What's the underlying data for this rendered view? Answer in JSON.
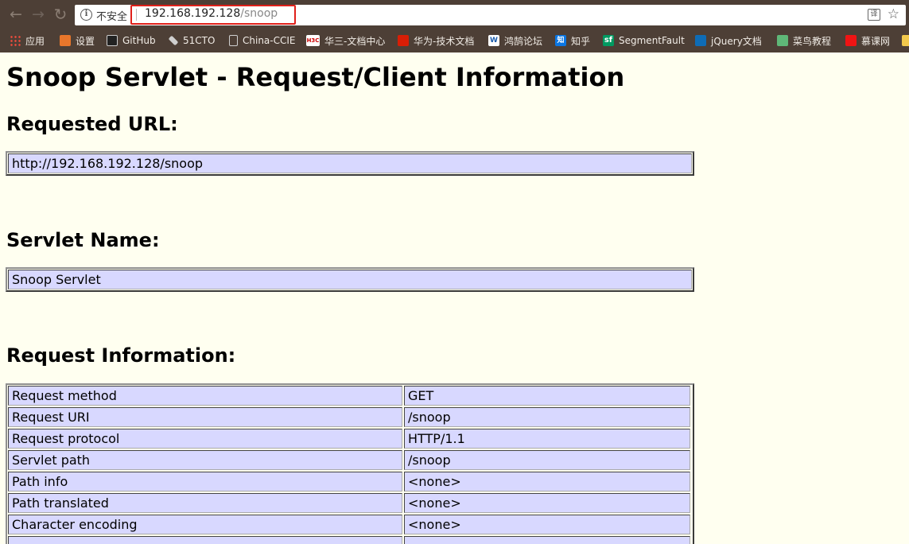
{
  "browser": {
    "insecure_label": "不安全",
    "url_host": "192.168.192.128",
    "url_path": "/snoop",
    "translate_icon": "translate-icon",
    "star_icon": "bookmark-star-icon",
    "bookmarks": [
      {
        "label": "应用",
        "icon": "apps-icon"
      },
      {
        "label": "设置",
        "icon": "gear-icon"
      },
      {
        "label": "GitHub",
        "icon": "github-icon"
      },
      {
        "label": "51CTO",
        "icon": "51cto-icon"
      },
      {
        "label": "China-CCIE",
        "icon": "document-icon"
      },
      {
        "label": "华三-文档中心",
        "icon": "h3c-icon"
      },
      {
        "label": "华为-技术文档",
        "icon": "huawei-icon"
      },
      {
        "label": "鸿鹄论坛",
        "icon": "hongjing-icon"
      },
      {
        "label": "知乎",
        "icon": "zhihu-icon"
      },
      {
        "label": "SegmentFault",
        "icon": "segmentfault-icon"
      },
      {
        "label": "jQuery文档",
        "icon": "jquery-icon"
      },
      {
        "label": "菜鸟教程",
        "icon": "runoob-icon"
      },
      {
        "label": "慕课网",
        "icon": "mooc-icon"
      }
    ]
  },
  "page": {
    "title": "Snoop Servlet - Request/Client Information",
    "requested_url_heading": "Requested URL:",
    "requested_url_value": "http://192.168.192.128/snoop",
    "servlet_name_heading": "Servlet Name:",
    "servlet_name_value": "Snoop Servlet",
    "request_info_heading": "Request Information:",
    "request_info_rows": [
      {
        "key": "Request method",
        "value": "GET"
      },
      {
        "key": "Request URI",
        "value": "/snoop"
      },
      {
        "key": "Request protocol",
        "value": "HTTP/1.1"
      },
      {
        "key": "Servlet path",
        "value": "/snoop"
      },
      {
        "key": "Path info",
        "value": "<none>"
      },
      {
        "key": "Path translated",
        "value": "<none>"
      },
      {
        "key": "Character encoding",
        "value": "<none>"
      },
      {
        "key": "",
        "value": ""
      }
    ]
  }
}
